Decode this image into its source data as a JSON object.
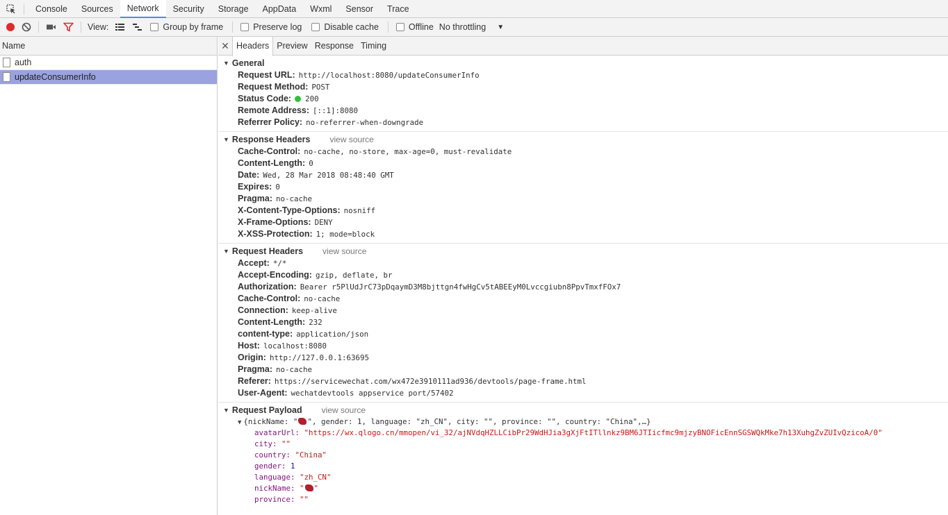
{
  "tabs": [
    "Console",
    "Sources",
    "Network",
    "Security",
    "Storage",
    "AppData",
    "Wxml",
    "Sensor",
    "Trace"
  ],
  "active_tab": "Network",
  "toolbar": {
    "view_label": "View:",
    "group_by_frame": "Group by frame",
    "preserve_log": "Preserve log",
    "disable_cache": "Disable cache",
    "offline": "Offline",
    "throttling": "No throttling",
    "record_color": "#e02b2b",
    "filter_color": "#e02b2b"
  },
  "requests": {
    "header": "Name",
    "items": [
      {
        "name": "auth",
        "selected": false
      },
      {
        "name": "updateConsumerInfo",
        "selected": true
      }
    ]
  },
  "detail_tabs": [
    "Headers",
    "Preview",
    "Response",
    "Timing"
  ],
  "general": {
    "title": "General",
    "rows": [
      {
        "key": "Request URL:",
        "value": "http://localhost:8080/updateConsumerInfo"
      },
      {
        "key": "Request Method:",
        "value": "POST"
      },
      {
        "key": "Status Code:",
        "value": "200"
      },
      {
        "key": "Remote Address:",
        "value": "[::1]:8080"
      },
      {
        "key": "Referrer Policy:",
        "value": "no-referrer-when-downgrade"
      }
    ]
  },
  "response_headers": {
    "title": "Response Headers",
    "view_source": "view source",
    "rows": [
      {
        "key": "Cache-Control:",
        "value": "no-cache, no-store, max-age=0, must-revalidate"
      },
      {
        "key": "Content-Length:",
        "value": "0"
      },
      {
        "key": "Date:",
        "value": "Wed, 28 Mar 2018 08:48:40 GMT"
      },
      {
        "key": "Expires:",
        "value": "0"
      },
      {
        "key": "Pragma:",
        "value": "no-cache"
      },
      {
        "key": "X-Content-Type-Options:",
        "value": "nosniff"
      },
      {
        "key": "X-Frame-Options:",
        "value": "DENY"
      },
      {
        "key": "X-XSS-Protection:",
        "value": "1; mode=block"
      }
    ]
  },
  "request_headers": {
    "title": "Request Headers",
    "view_source": "view source",
    "rows": [
      {
        "key": "Accept:",
        "value": "*/*"
      },
      {
        "key": "Accept-Encoding:",
        "value": "gzip, deflate, br"
      },
      {
        "key": "Authorization:",
        "value": "Bearer r5PlUdJrC73pDqaymD3M8bjttgn4fwHgCv5tABEEyM0Lvccgiubn8PpvTmxfFOx7"
      },
      {
        "key": "Cache-Control:",
        "value": "no-cache"
      },
      {
        "key": "Connection:",
        "value": "keep-alive"
      },
      {
        "key": "Content-Length:",
        "value": "232"
      },
      {
        "key": "content-type:",
        "value": "application/json"
      },
      {
        "key": "Host:",
        "value": "localhost:8080"
      },
      {
        "key": "Origin:",
        "value": "http://127.0.0.1:63695"
      },
      {
        "key": "Pragma:",
        "value": "no-cache"
      },
      {
        "key": "Referer:",
        "value": "https://servicewechat.com/wx472e3910111ad936/devtools/page-frame.html"
      },
      {
        "key": "User-Agent:",
        "value": "wechatdevtools appservice port/57402"
      }
    ]
  },
  "request_payload": {
    "title": "Request Payload",
    "view_source": "view source",
    "summary_pre": "{nickName: \"",
    "summary_post": "\", gender: 1, language: \"zh_CN\", city: \"\", province: \"\", country: \"China\",…}",
    "fields": {
      "avatarUrl_key": "avatarUrl:",
      "avatarUrl_val": "\"https://wx.qlogo.cn/mmopen/vi_32/ajNVdqHZLLCibPr29WdHJia3gXjFtITllnkz9BM6JTIicfmc9mjzyBNOFicEnnSGSWQkMke7h13XuhgZvZUIvQzicoA/0\"",
      "city_key": "city:",
      "city_val": "\"\"",
      "country_key": "country:",
      "country_val": "\"China\"",
      "gender_key": "gender:",
      "gender_val": "1",
      "language_key": "language:",
      "language_val": "\"zh_CN\"",
      "nickName_key": "nickName:",
      "nickName_pre": "\"",
      "nickName_post": "\"",
      "province_key": "province:",
      "province_val": "\"\""
    }
  }
}
